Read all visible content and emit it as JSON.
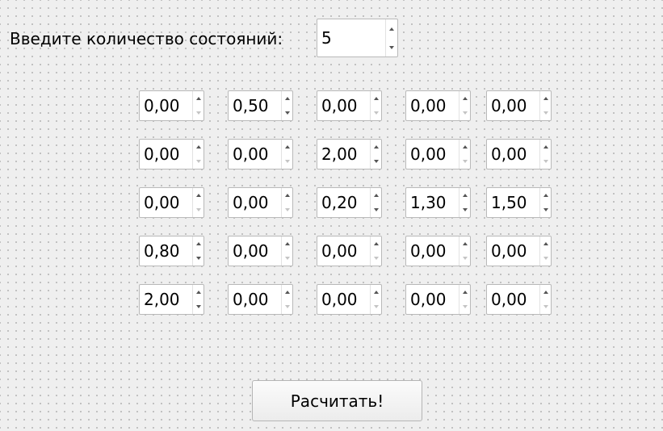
{
  "states": {
    "label": "Введите количество состояний:",
    "value": "5"
  },
  "matrix": {
    "rows": [
      [
        "0,00",
        "0,50",
        "0,00",
        "0,00",
        "0,00"
      ],
      [
        "0,00",
        "0,00",
        "2,00",
        "0,00",
        "0,00"
      ],
      [
        "0,00",
        "0,00",
        "0,20",
        "1,30",
        "1,50"
      ],
      [
        "0,80",
        "0,00",
        "0,00",
        "0,00",
        "0,00"
      ],
      [
        "2,00",
        "0,00",
        "0,00",
        "0,00",
        "0,00"
      ]
    ]
  },
  "calculate_button": {
    "label": "Расчитать!"
  },
  "colors": {
    "background": "#efefef",
    "dot_grid": "#b4b4b4",
    "field_border": "#b9b9b9"
  },
  "icons": {
    "increment": "arrow-up-icon",
    "decrement": "arrow-down-icon"
  }
}
